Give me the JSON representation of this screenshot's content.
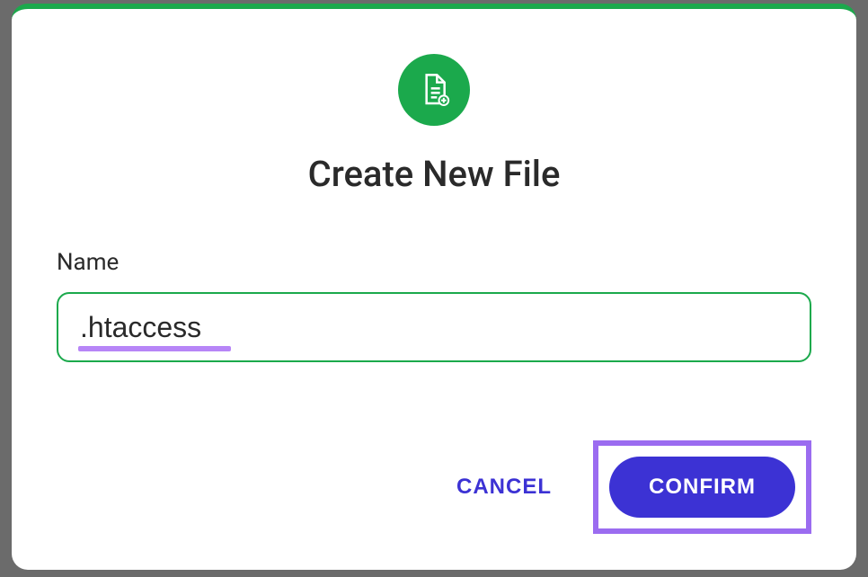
{
  "dialog": {
    "title": "Create New File",
    "field_label": "Name",
    "input_value": ".htaccess",
    "cancel_label": "CANCEL",
    "confirm_label": "CONFIRM"
  },
  "colors": {
    "accent_green": "#1ba94c",
    "accent_purple": "#3c32d4",
    "highlight_purple": "#9b6cf0",
    "underline_purple": "#b785f7"
  }
}
